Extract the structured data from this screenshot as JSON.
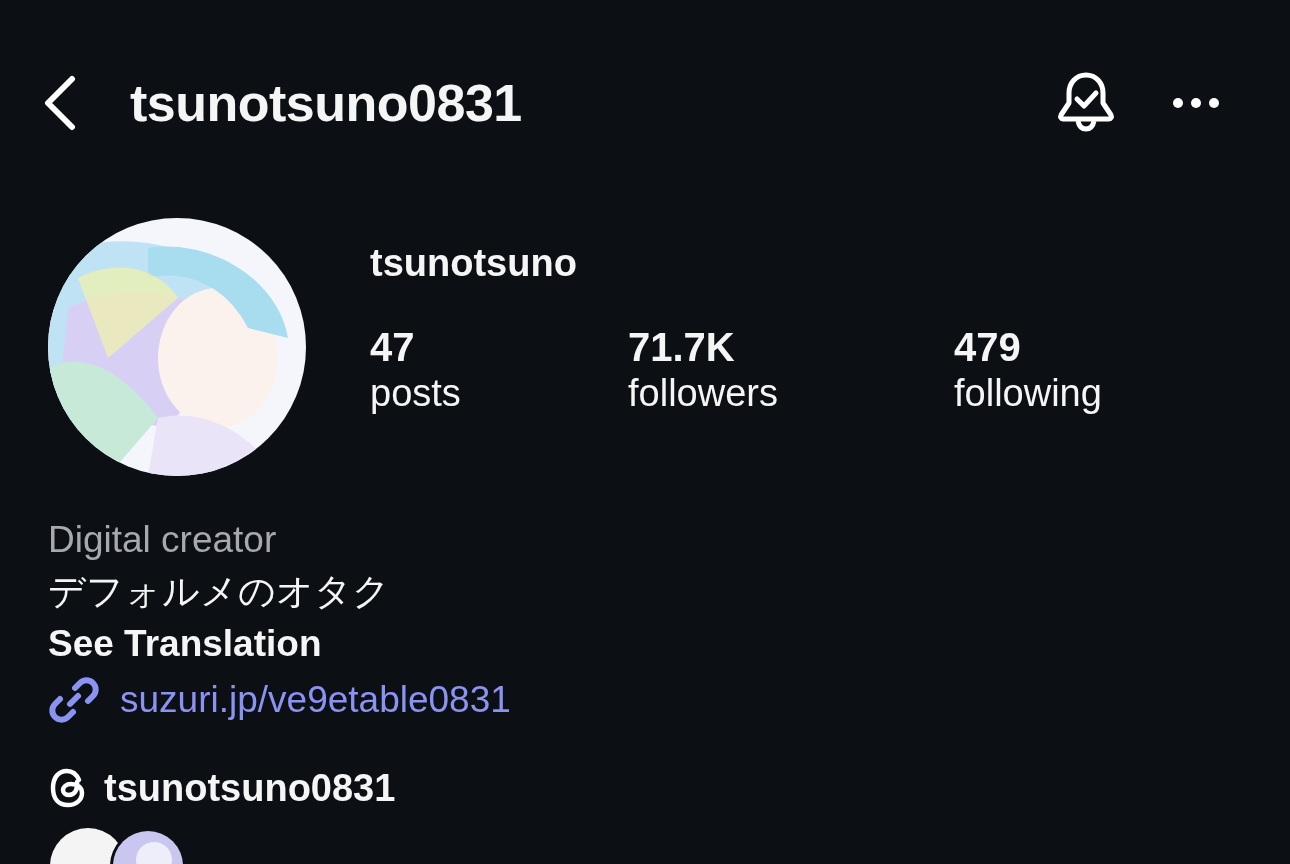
{
  "header": {
    "username": "tsunotsuno0831"
  },
  "profile": {
    "display_name": "tsunotsuno",
    "stats": [
      {
        "value": "47",
        "label": "posts"
      },
      {
        "value": "71.7K",
        "label": "followers"
      },
      {
        "value": "479",
        "label": "following"
      }
    ]
  },
  "bio": {
    "category": "Digital creator",
    "text": "デフォルメのオタク",
    "translate": "See Translation",
    "link": "suzuri.jp/ve9etable0831",
    "threads": "tsunotsuno0831"
  }
}
